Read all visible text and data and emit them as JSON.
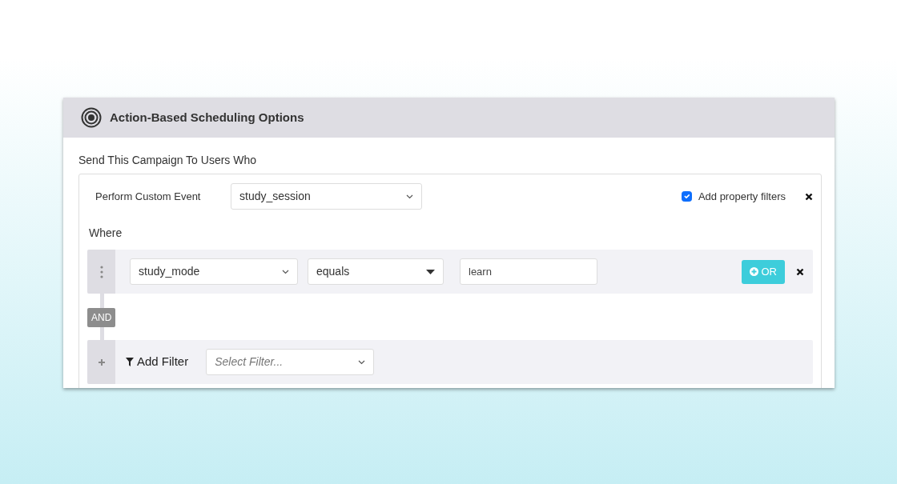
{
  "header": {
    "title": "Action-Based Scheduling Options"
  },
  "section_title": "Send This Campaign To Users Who",
  "trigger": {
    "label": "Perform Custom Event",
    "event": "study_session"
  },
  "property_filters": {
    "label": "Add property filters",
    "checked": true
  },
  "where_label": "Where",
  "filters": [
    {
      "property": "study_mode",
      "operator": "equals",
      "value": "learn",
      "or_button": "OR"
    }
  ],
  "connector": "AND",
  "add_filter": {
    "label": "Add Filter",
    "placeholder": "Select Filter..."
  }
}
